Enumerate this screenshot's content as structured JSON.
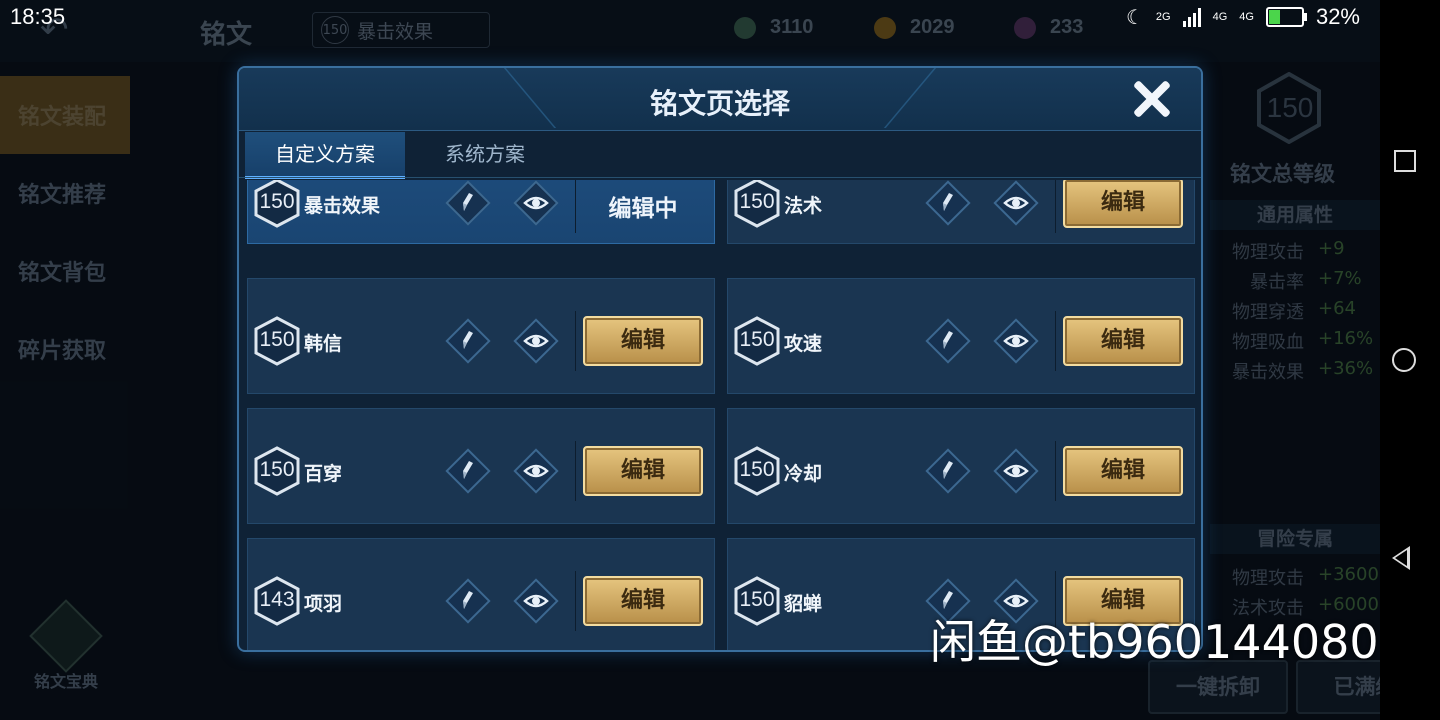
{
  "status_bar": {
    "time": "18:35",
    "signal1": "2G",
    "signal2": "4G",
    "signal3": "4G",
    "battery": "32%",
    "battery_level": 0.32
  },
  "background": {
    "title": "铭文",
    "current_page": {
      "level": "150",
      "name": "暴击效果"
    },
    "resources": [
      {
        "value": "3110",
        "color": "#3f6a5a"
      },
      {
        "value": "2029",
        "color": "#8a6a25"
      },
      {
        "value": "233",
        "color": "#5a3a6a"
      }
    ],
    "sidebar": [
      "铭文装配",
      "铭文推荐",
      "铭文背包",
      "碎片获取"
    ],
    "codex_label": "铭文宝典",
    "total_level": "150",
    "total_level_label": "铭文总等级",
    "general_section": "通用属性",
    "general_attrs": [
      {
        "name": "物理攻击",
        "value": "+9"
      },
      {
        "name": "暴击率",
        "value": "+7%"
      },
      {
        "name": "物理穿透",
        "value": "+64"
      },
      {
        "name": "物理吸血",
        "value": "+16%"
      },
      {
        "name": "暴击效果",
        "value": "+36%"
      }
    ],
    "adventure_section": "冒险专属",
    "adventure_attrs": [
      {
        "name": "物理攻击",
        "value": "+3600"
      },
      {
        "name": "法术攻击",
        "value": "+6000"
      }
    ],
    "btn_unload": "一键拆卸",
    "btn_max": "已满级"
  },
  "modal": {
    "title": "铭文页选择",
    "tabs": [
      {
        "label": "自定义方案",
        "active": true
      },
      {
        "label": "系统方案",
        "active": false
      }
    ],
    "pages": [
      {
        "level": "150",
        "name": "暴击效果",
        "action": "编辑中",
        "current": true
      },
      {
        "level": "150",
        "name": "法术",
        "action": "编辑",
        "current": false
      },
      {
        "level": "150",
        "name": "韩信",
        "action": "编辑",
        "current": false
      },
      {
        "level": "150",
        "name": "攻速",
        "action": "编辑",
        "current": false
      },
      {
        "level": "150",
        "name": "百穿",
        "action": "编辑",
        "current": false
      },
      {
        "level": "150",
        "name": "冷却",
        "action": "编辑",
        "current": false
      },
      {
        "level": "143",
        "name": "项羽",
        "action": "编辑",
        "current": false
      },
      {
        "level": "150",
        "name": "貂蝉",
        "action": "编辑",
        "current": false
      }
    ]
  },
  "watermark": "闲鱼@tb960144080",
  "icons": {
    "rename": "pencil-icon",
    "preview": "eye-icon",
    "close": "close-icon"
  }
}
